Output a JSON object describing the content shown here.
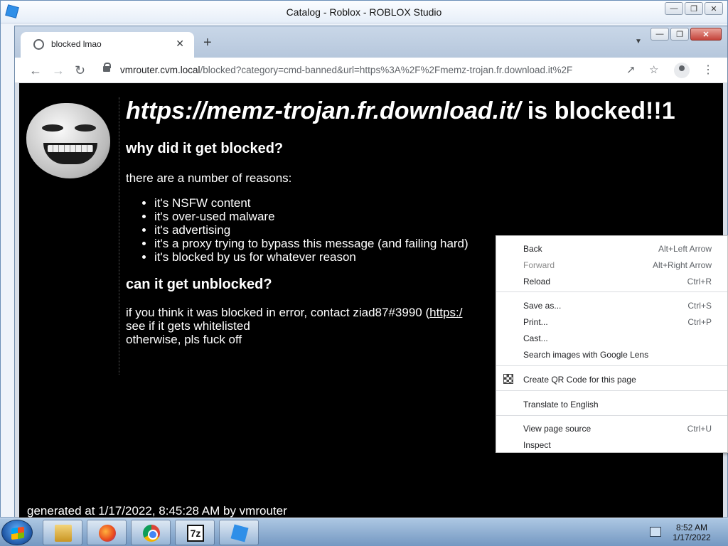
{
  "roblox_window": {
    "title": "Catalog - Roblox - ROBLOX Studio"
  },
  "chrome": {
    "tab_title": "blocked lmao",
    "address": {
      "host": "vmrouter.cvm.local",
      "path": "/blocked?category=cmd-banned&url=https%3A%2F%2Fmemz-trojan.fr.download.it%2F"
    }
  },
  "page": {
    "blocked_url": "https://memz-trojan.fr.download.it/",
    "headline_suffix": " is blocked!!1",
    "why_heading": "why did it get blocked?",
    "reasons_intro": "there are a number of reasons:",
    "reasons": [
      "it's NSFW content",
      "it's over-used malware",
      "it's advertising",
      "it's a proxy trying to bypass this message (and failing hard)",
      "it's blocked by us for whatever reason"
    ],
    "unblock_heading": "can it get unblocked?",
    "unblock_text": "if you think it was blocked in error, contact ziad87#3990 (",
    "unblock_link": "https:/",
    "unblock_line2": "see if it gets whitelisted",
    "unblock_line3": "otherwise, pls fuck off",
    "footer": "generated at 1/17/2022, 8:45:28 AM by vmrouter"
  },
  "context_menu": {
    "items": [
      {
        "label": "Back",
        "shortcut": "Alt+Left Arrow"
      },
      {
        "label": "Forward",
        "shortcut": "Alt+Right Arrow"
      },
      {
        "label": "Reload",
        "shortcut": "Ctrl+R"
      },
      {
        "label": "Save as...",
        "shortcut": "Ctrl+S"
      },
      {
        "label": "Print...",
        "shortcut": "Ctrl+P"
      },
      {
        "label": "Cast...",
        "shortcut": ""
      },
      {
        "label": "Search images with Google Lens",
        "shortcut": ""
      },
      {
        "label": "Create QR Code for this page",
        "shortcut": ""
      },
      {
        "label": "Translate to English",
        "shortcut": ""
      },
      {
        "label": "View page source",
        "shortcut": "Ctrl+U"
      },
      {
        "label": "Inspect",
        "shortcut": ""
      }
    ]
  },
  "taskbar": {
    "apps": [
      "windows-explorer",
      "firefox",
      "google-chrome",
      "7-zip",
      "roblox-studio"
    ],
    "sevenzip_label": "7z",
    "clock": {
      "time": "8:52 AM",
      "date": "1/17/2022"
    }
  }
}
